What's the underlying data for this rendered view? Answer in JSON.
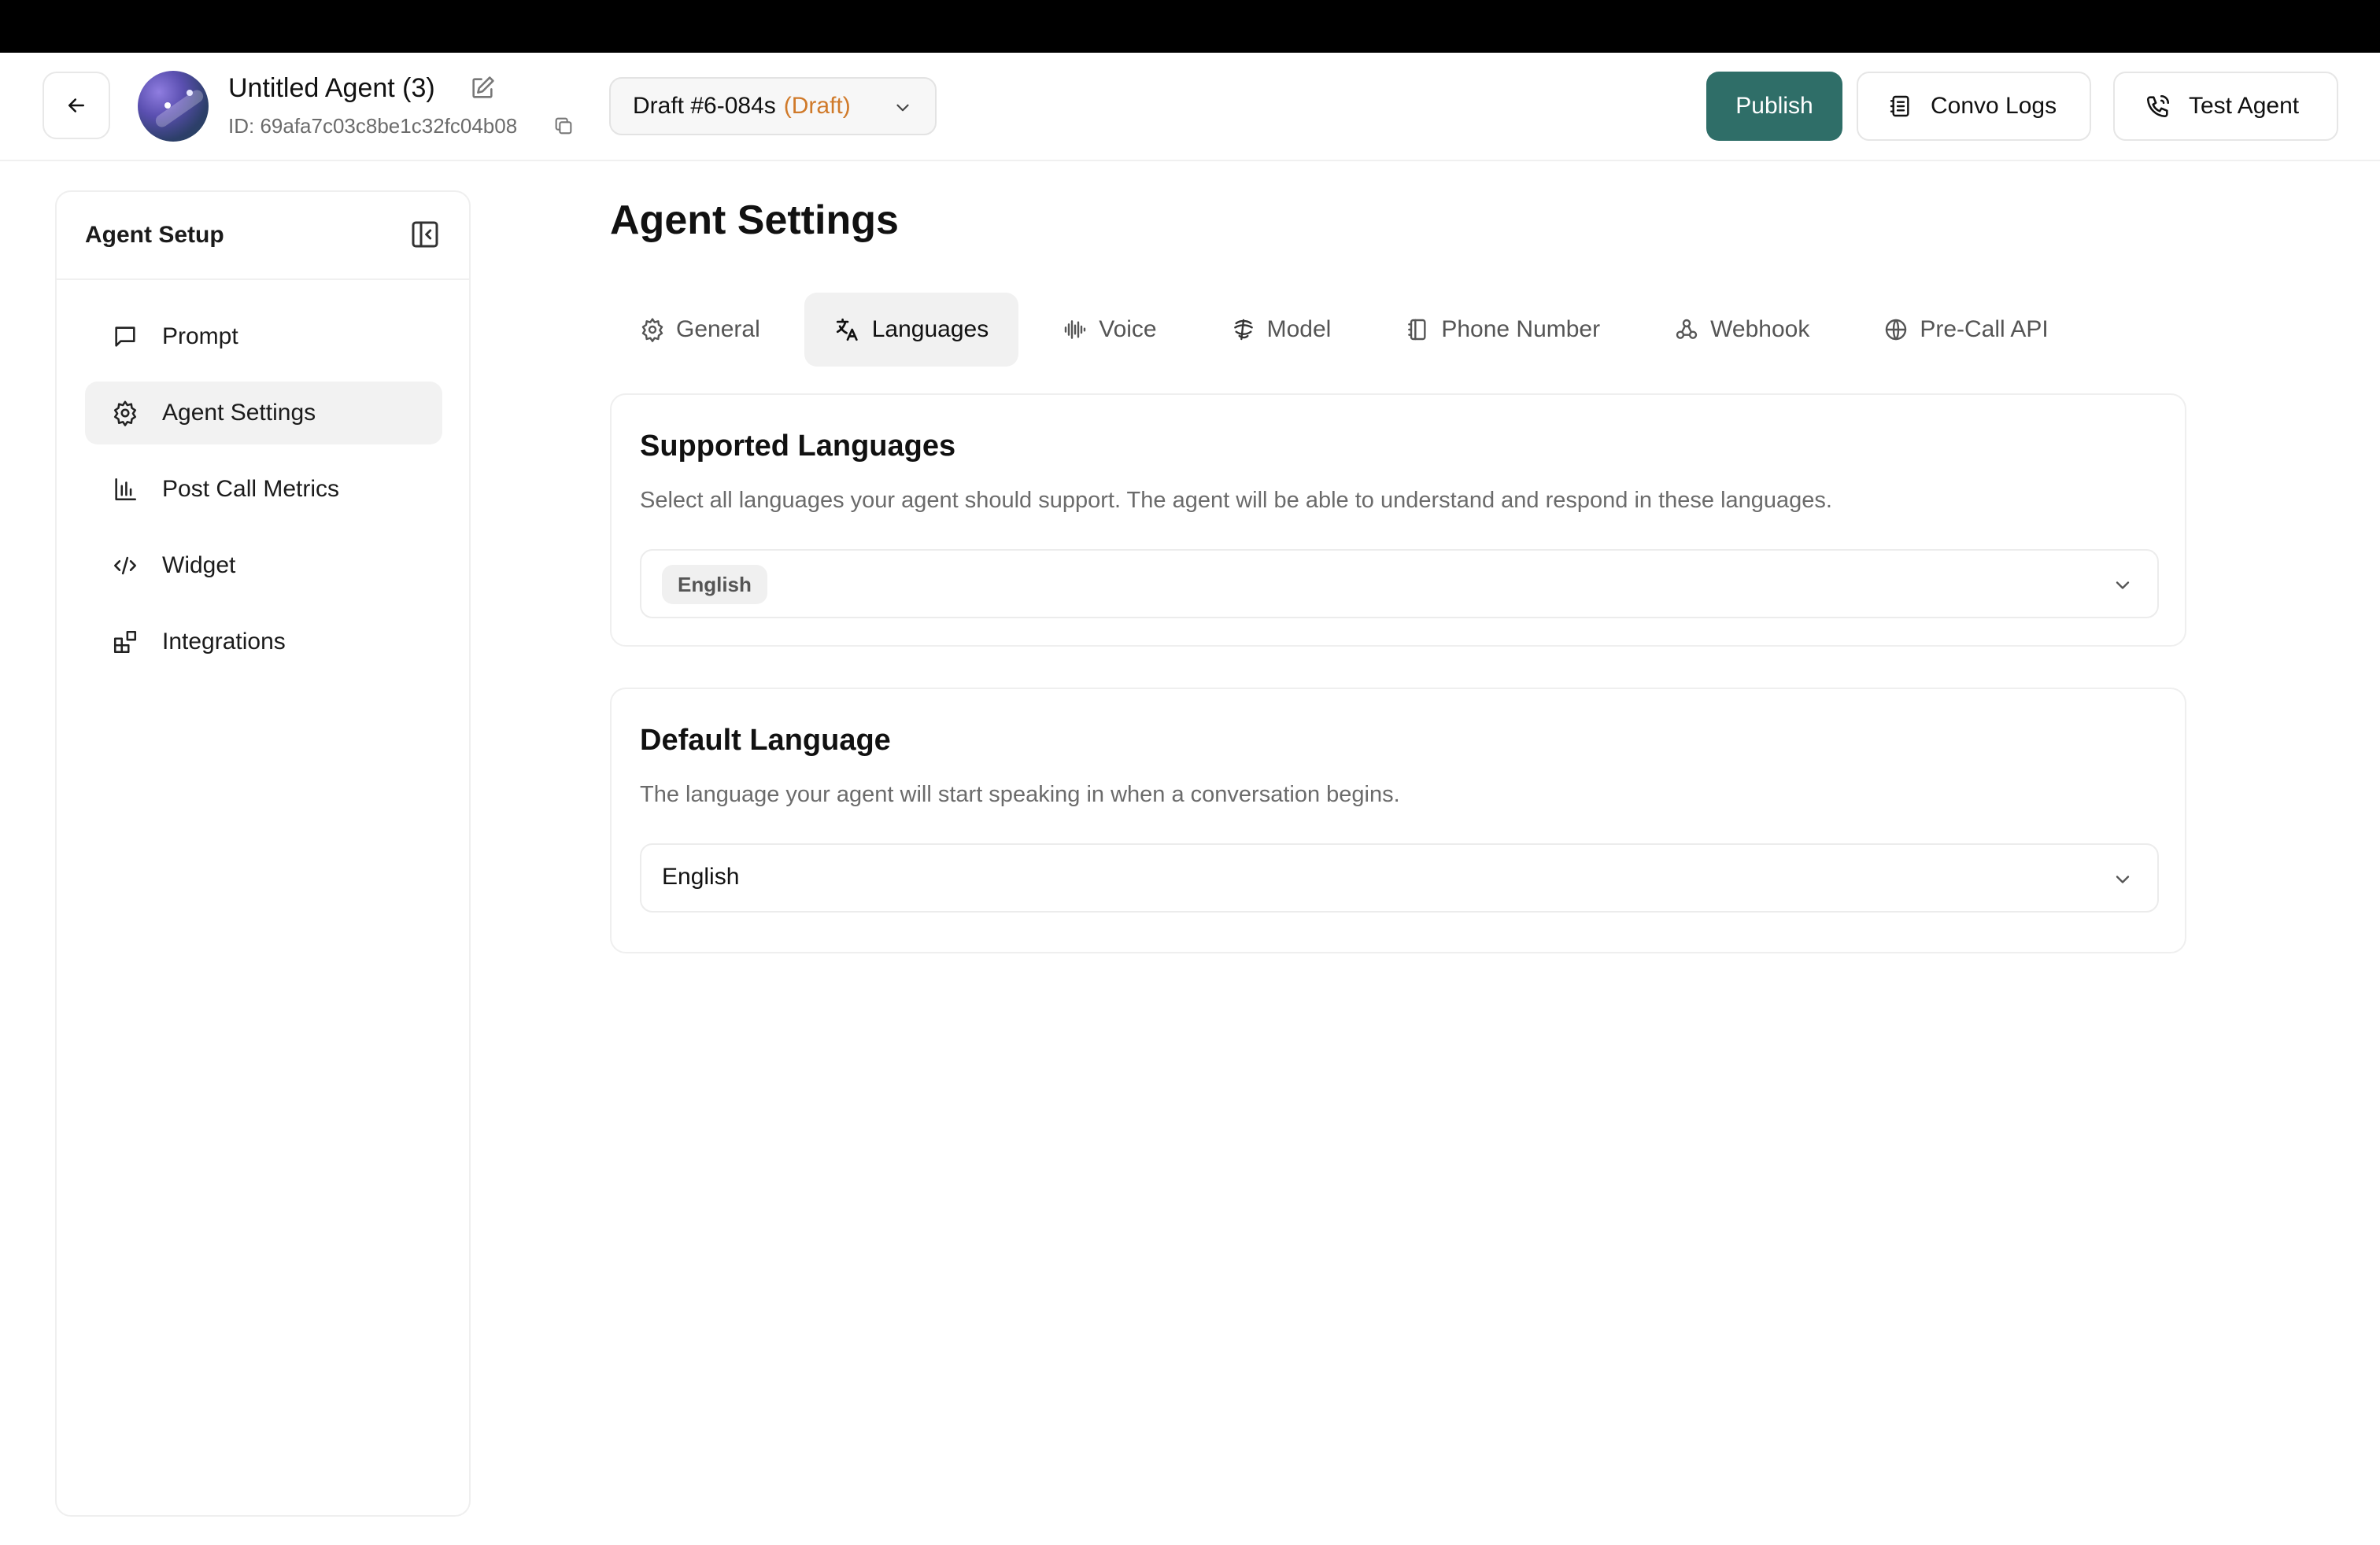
{
  "header": {
    "agent_name": "Untitled Agent (3)",
    "agent_id": "ID: 69afa7c03c8be1c32fc04b08",
    "draft_label": "Draft #6-084s",
    "draft_status": "(Draft)",
    "publish_label": "Publish",
    "convo_logs_label": "Convo Logs",
    "test_agent_label": "Test Agent"
  },
  "sidebar": {
    "title": "Agent Setup",
    "items": [
      {
        "label": "Prompt",
        "icon": "chat-icon"
      },
      {
        "label": "Agent Settings",
        "icon": "gear-icon",
        "active": true
      },
      {
        "label": "Post Call Metrics",
        "icon": "bar-chart-icon"
      },
      {
        "label": "Widget",
        "icon": "code-icon"
      },
      {
        "label": "Integrations",
        "icon": "blocks-icon"
      }
    ]
  },
  "main": {
    "title": "Agent Settings",
    "tabs": [
      {
        "label": "General",
        "icon": "gear-icon"
      },
      {
        "label": "Languages",
        "icon": "translate-icon",
        "active": true
      },
      {
        "label": "Voice",
        "icon": "waveform-icon"
      },
      {
        "label": "Model",
        "icon": "model-icon"
      },
      {
        "label": "Phone Number",
        "icon": "phone-book-icon"
      },
      {
        "label": "Webhook",
        "icon": "webhook-icon"
      },
      {
        "label": "Pre-Call API",
        "icon": "globe-icon"
      }
    ],
    "supported_languages": {
      "title": "Supported Languages",
      "description": "Select all languages your agent should support. The agent will be able to understand and respond in these languages.",
      "selected": [
        "English"
      ]
    },
    "default_language": {
      "title": "Default Language",
      "description": "The language your agent will start speaking in when a conversation begins.",
      "value": "English"
    }
  },
  "colors": {
    "accent": "#2f6e68",
    "draft_status": "#d07a2a"
  }
}
